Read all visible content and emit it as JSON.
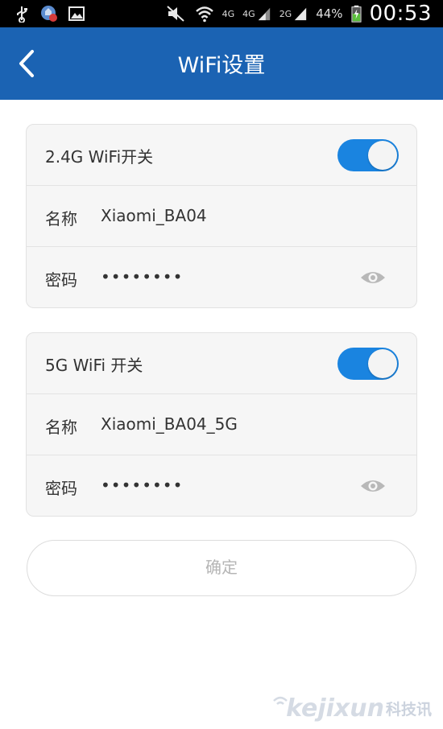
{
  "status_bar": {
    "net_4g_a": "4G",
    "net_4g_b": "4G",
    "net_2g": "2G",
    "battery": "44%",
    "time": "00:53",
    "icons": [
      "usb-icon",
      "shield-alert-icon",
      "image-icon",
      "mute-icon",
      "wifi-icon",
      "signal-icon",
      "battery-icon"
    ]
  },
  "header": {
    "title": "WiFi设置"
  },
  "wifi_24g": {
    "toggle_label": "2.4G WiFi开关",
    "toggle_on": true,
    "name_label": "名称",
    "name_value": "Xiaomi_BA04",
    "password_label": "密码",
    "password_value": "••••••••"
  },
  "wifi_5g": {
    "toggle_label": "5G WiFi 开关",
    "toggle_on": true,
    "name_label": "名称",
    "name_value": "Xiaomi_BA04_5G",
    "password_label": "密码",
    "password_value": "••••••••"
  },
  "confirm_label": "确定",
  "watermark": {
    "latin": "kejixun",
    "cn": "科技讯"
  },
  "colors": {
    "header_bg": "#1b63b3",
    "toggle_on": "#1a84e0",
    "card_bg": "#f6f6f6"
  }
}
